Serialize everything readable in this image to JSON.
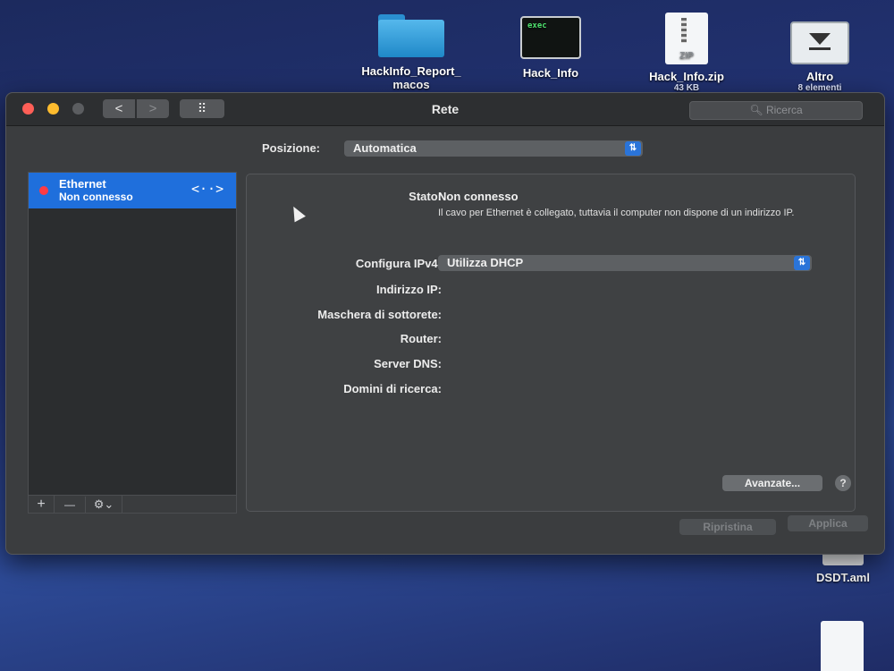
{
  "desktop": {
    "icons": [
      {
        "label": "HackInfo_Report_",
        "label2": "macos",
        "sub": ""
      },
      {
        "label": "Hack_Info",
        "label2": "",
        "sub": "",
        "exec_text": "exec"
      },
      {
        "label": "Hack_Info.zip",
        "label2": "",
        "sub": "43 KB",
        "zip_text": "ZIP"
      },
      {
        "label": "Altro",
        "label2": "",
        "sub": "8 elementi"
      },
      {
        "label": "DSDT.aml",
        "label2": "",
        "sub": ""
      }
    ]
  },
  "window": {
    "title": "Rete",
    "search_placeholder": "Ricerca",
    "grid_icon": "⠿",
    "back_icon": "<",
    "forward_icon": ">"
  },
  "location": {
    "label": "Posizione:",
    "value": "Automatica"
  },
  "sidebar": {
    "services": [
      {
        "name": "Ethernet",
        "status": "Non connesso",
        "status_color": "#ff3b45",
        "icon": "<··>"
      }
    ],
    "toolbar": {
      "add": "+",
      "remove": "—",
      "gear": "⚙⌄"
    }
  },
  "details": {
    "status_label": "Stato:",
    "status_value": "Non connesso",
    "status_description": "Il cavo per Ethernet è collegato, tuttavia il computer non dispone di un indirizzo IP.",
    "configure_label": "Configura IPv4:",
    "configure_value": "Utilizza DHCP",
    "fields": [
      {
        "label": "Indirizzo IP:",
        "value": ""
      },
      {
        "label": "Maschera di sottorete:",
        "value": ""
      },
      {
        "label": "Router:",
        "value": ""
      },
      {
        "label": "Server DNS:",
        "value": ""
      },
      {
        "label": "Domini di ricerca:",
        "value": ""
      }
    ],
    "advanced_button": "Avanzate...",
    "help_button": "?"
  },
  "footer": {
    "revert_button": "Ripristina",
    "apply_button": "Applica"
  },
  "colors": {
    "accent": "#1f6fdc",
    "status_disconnected": "#ff3b45"
  }
}
